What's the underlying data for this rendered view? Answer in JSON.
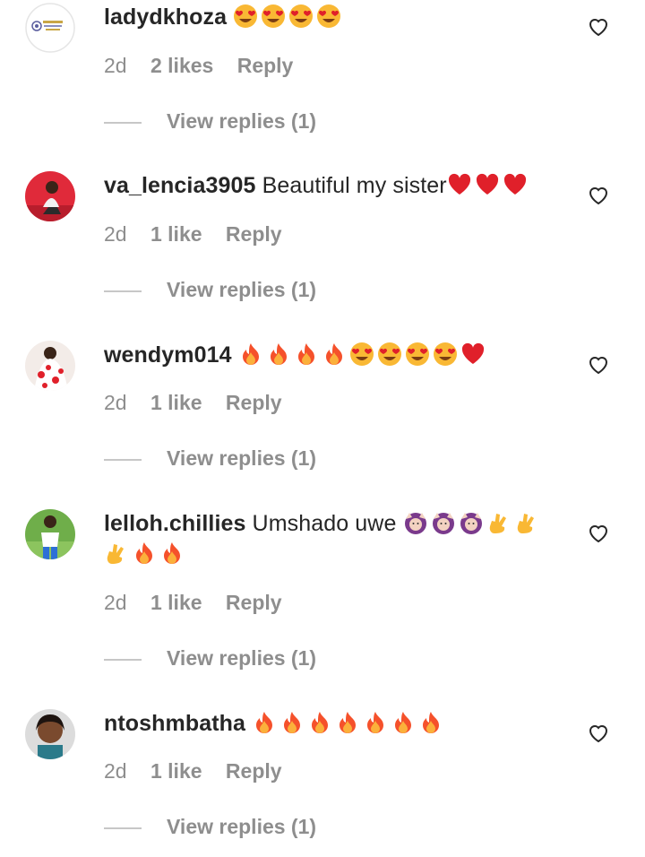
{
  "comments": [
    {
      "username": "ladydkhoza",
      "text": "",
      "emoji_line1": [
        "heart-eyes-icon",
        "heart-eyes-icon",
        "heart-eyes-icon",
        "heart-eyes-icon"
      ],
      "emoji_line2": [],
      "time": "2d",
      "likes": "2 likes",
      "reply": "Reply",
      "view_replies": "View replies (1)",
      "avatar": "logo-avatar"
    },
    {
      "username": "va_lencia3905",
      "text": "Beautiful my sister",
      "emoji_line1": [
        "red-heart-icon",
        "red-heart-icon",
        "red-heart-icon"
      ],
      "emoji_line2": [],
      "time": "2d",
      "likes": "1 like",
      "reply": "Reply",
      "view_replies": "View replies (1)",
      "avatar": "photo-avatar-red"
    },
    {
      "username": "wendym014",
      "text": "",
      "emoji_line1": [
        "fire-icon",
        "fire-icon",
        "fire-icon",
        "fire-icon",
        "heart-eyes-icon",
        "heart-eyes-icon",
        "heart-eyes-icon",
        "heart-eyes-icon",
        "red-heart-icon"
      ],
      "emoji_line2": [],
      "time": "2d",
      "likes": "1 like",
      "reply": "Reply",
      "view_replies": "View replies (1)",
      "avatar": "photo-avatar-floral"
    },
    {
      "username": "lelloh.chillies",
      "text": "Umshado uwe",
      "emoji_line1": [
        "woman-hands-raised-icon",
        "woman-hands-raised-icon",
        "woman-hands-raised-icon",
        "crossed-fingers-icon",
        "crossed-fingers-icon"
      ],
      "emoji_line2": [
        "crossed-fingers-icon",
        "fire-icon",
        "fire-icon"
      ],
      "time": "2d",
      "likes": "1 like",
      "reply": "Reply",
      "view_replies": "View replies (1)",
      "avatar": "photo-avatar-green"
    },
    {
      "username": "ntoshmbatha",
      "text": "",
      "emoji_line1": [
        "fire-icon",
        "fire-icon",
        "fire-icon",
        "fire-icon",
        "fire-icon",
        "fire-icon",
        "fire-icon"
      ],
      "emoji_line2": [],
      "time": "2d",
      "likes": "1 like",
      "reply": "Reply",
      "view_replies": "View replies (1)",
      "avatar": "photo-avatar-selfie"
    }
  ],
  "colors": {
    "username": "#262626",
    "meta": "#8e8e8e",
    "divider": "#c7c7c7",
    "heart_outline": "#262626",
    "emoji_red": "#e0202a",
    "emoji_yellow": "#f9b834",
    "fire_orange": "#f5512b"
  }
}
